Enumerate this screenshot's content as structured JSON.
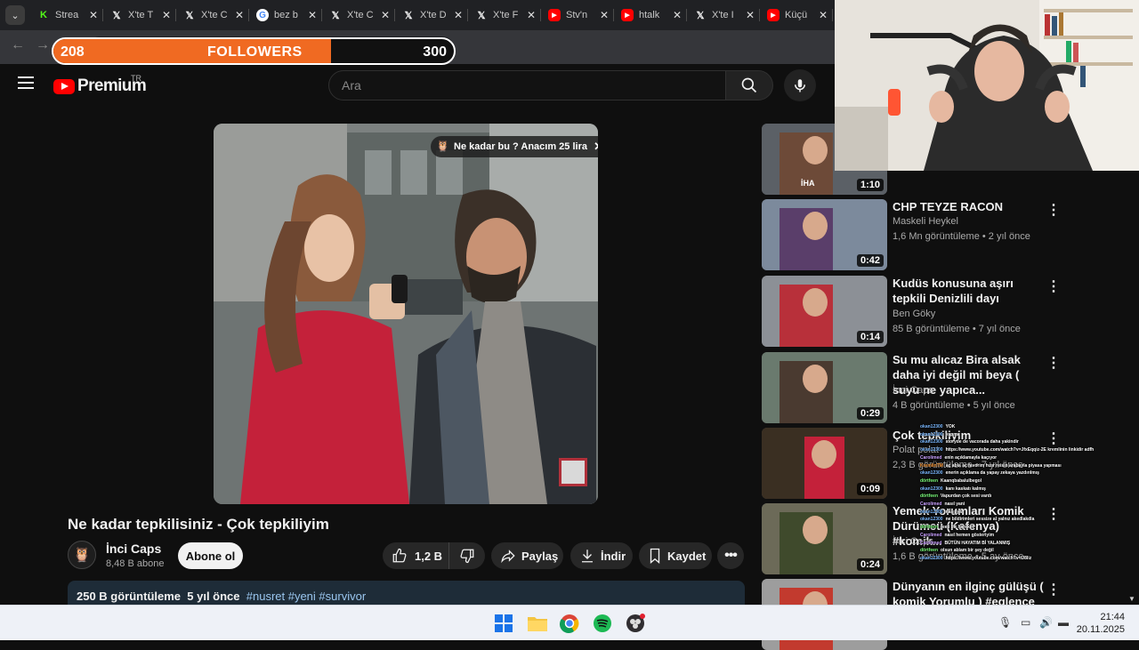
{
  "browser": {
    "tabs": [
      {
        "icon": "kick-icon",
        "title": "Strea"
      },
      {
        "icon": "x-icon",
        "title": "X'te T"
      },
      {
        "icon": "x-icon",
        "title": "X'te C"
      },
      {
        "icon": "google-icon",
        "title": "bez b"
      },
      {
        "icon": "x-icon",
        "title": "X'te C"
      },
      {
        "icon": "x-icon",
        "title": "X'te D"
      },
      {
        "icon": "x-icon",
        "title": "X'te F"
      },
      {
        "icon": "youtube-icon",
        "title": "Stv'n"
      },
      {
        "icon": "youtube-icon",
        "title": "htalk"
      },
      {
        "icon": "x-icon",
        "title": "X'te I"
      },
      {
        "icon": "youtube-icon",
        "title": "Küçü"
      }
    ]
  },
  "followers_goal": {
    "current": "208",
    "label": "FOLLOWERS",
    "goal": "300",
    "progress_fraction": 0.6933
  },
  "youtube": {
    "logo_text": "Premium",
    "country_code": "TR",
    "search_placeholder": "Ara"
  },
  "video": {
    "overlay_tooltip": "Ne kadar bu ? Anacım 25 lira",
    "title": "Ne kadar tepkilisiniz - Çok tepkiliyim",
    "channel": {
      "name": "İnci Caps",
      "subscribers": "8,48 B abone",
      "avatar_label": "İnci Caps"
    },
    "subscribe_label": "Abone ol",
    "likes": "1,2 B",
    "share_label": "Paylaş",
    "download_label": "İndir",
    "save_label": "Kaydet",
    "more_label": "•••",
    "views": "250 B görüntüleme",
    "age": "5 yıl önce",
    "hashtags": "#nusret #yeni #survivor"
  },
  "recommendations": [
    {
      "title": "",
      "channel": "",
      "meta": "",
      "duration": "1:10",
      "watermark": "İHA"
    },
    {
      "title": "CHP TEYZE RACON",
      "channel": "Maskeli Heykel",
      "meta": "1,6 Mn görüntüleme • 2 yıl önce",
      "duration": "0:42"
    },
    {
      "title": "Kudüs konusuna aşırı tepkili Denizlili dayı",
      "channel": "Ben Göky",
      "meta": "85 B görüntüleme • 7 yıl önce",
      "duration": "0:14"
    },
    {
      "title": "Su mu alıcaz Bira alsak daha iyi değil mi beya ( suyu ne yapıca...",
      "channel": "İnci Caps",
      "meta": "4 B görüntüleme • 5 yıl önce",
      "duration": "0:29"
    },
    {
      "title": "Çok tepkiliyim",
      "channel": "Polat polat",
      "meta": "2,3 B görüntüleme • 7 yıl önce",
      "duration": "0:09"
    },
    {
      "title": "Yemek Yorumları Komik Dürümcü (Kafenya) #komik...",
      "channel": "İnci Caps",
      "meta": "1,6 B görüntüleme • 5 ay önce",
      "duration": "0:24"
    },
    {
      "title": "Dünyanın en ilginç gülüşü ( komik Yorumlu ) #eglence",
      "channel": "",
      "meta": "",
      "duration": ""
    }
  ],
  "chat": [
    {
      "user": "okan12300",
      "color": "#7ab8ff",
      "text": "YOK"
    },
    {
      "user": "okan12300",
      "color": "#7ab8ff",
      "text": "yapma"
    },
    {
      "user": "okan12300",
      "color": "#7ab8ff",
      "text": "storyde de vacorada daha yakindir"
    },
    {
      "user": "okan12300",
      "color": "#7ab8ff",
      "text": "https://www.youtube.com/watch?v=JfxEqqiz-2E kremlinin linkidir adfh"
    },
    {
      "user": "Carolimed",
      "color": "#c9a0ff",
      "text": "enin açıklamayla kaçıyor"
    },
    {
      "user": "KremlinTM",
      "color": "#ff9f40",
      "text": "aç abla aç favorim hızır reisin arabayla piyasa yapması"
    },
    {
      "user": "okan12300",
      "color": "#7ab8ff",
      "text": "enerin açıklama da yapay zekaya yazdırılmış"
    },
    {
      "user": "dörtfeen",
      "color": "#7dff7d",
      "text": "Kaanqbabalulbegol"
    },
    {
      "user": "okan12300",
      "color": "#7ab8ff",
      "text": "kanı kaskatı kalmış"
    },
    {
      "user": "dörtfeen",
      "color": "#7dff7d",
      "text": "Vapurdan çok sesi vardı"
    },
    {
      "user": "Carolimed",
      "color": "#c9a0ff",
      "text": "nasıl yani"
    },
    {
      "user": "okan12300",
      "color": "#7ab8ff",
      "text": "nasıl ya"
    },
    {
      "user": "okan12300",
      "color": "#7ab8ff",
      "text": "ne bildirimleri sessize al yalnız akedlakdla"
    },
    {
      "user": "dörtfeen",
      "color": "#7dff7d",
      "text": "reeli bir hareket"
    },
    {
      "user": "Carolimed",
      "color": "#c9a0ff",
      "text": "nasıl hemen gösteriyim"
    },
    {
      "user": "Carolimed",
      "color": "#c9a0ff",
      "text": "BÜTÜN HAYATIM Bİ YALANMIŞ"
    },
    {
      "user": "dörtfeen",
      "color": "#7dff7d",
      "text": "olsun ablam bir şey değil"
    },
    {
      "user": "okan12300",
      "color": "#7ab8ff",
      "text": "https://www.youtube.com/watch?v=U8Iiz"
    }
  ],
  "taskbar": {
    "apps": [
      "windows-start-icon",
      "file-explorer-icon",
      "chrome-icon",
      "spotify-icon",
      "obs-icon"
    ],
    "time": "21:44",
    "date": "20.11.2025"
  }
}
